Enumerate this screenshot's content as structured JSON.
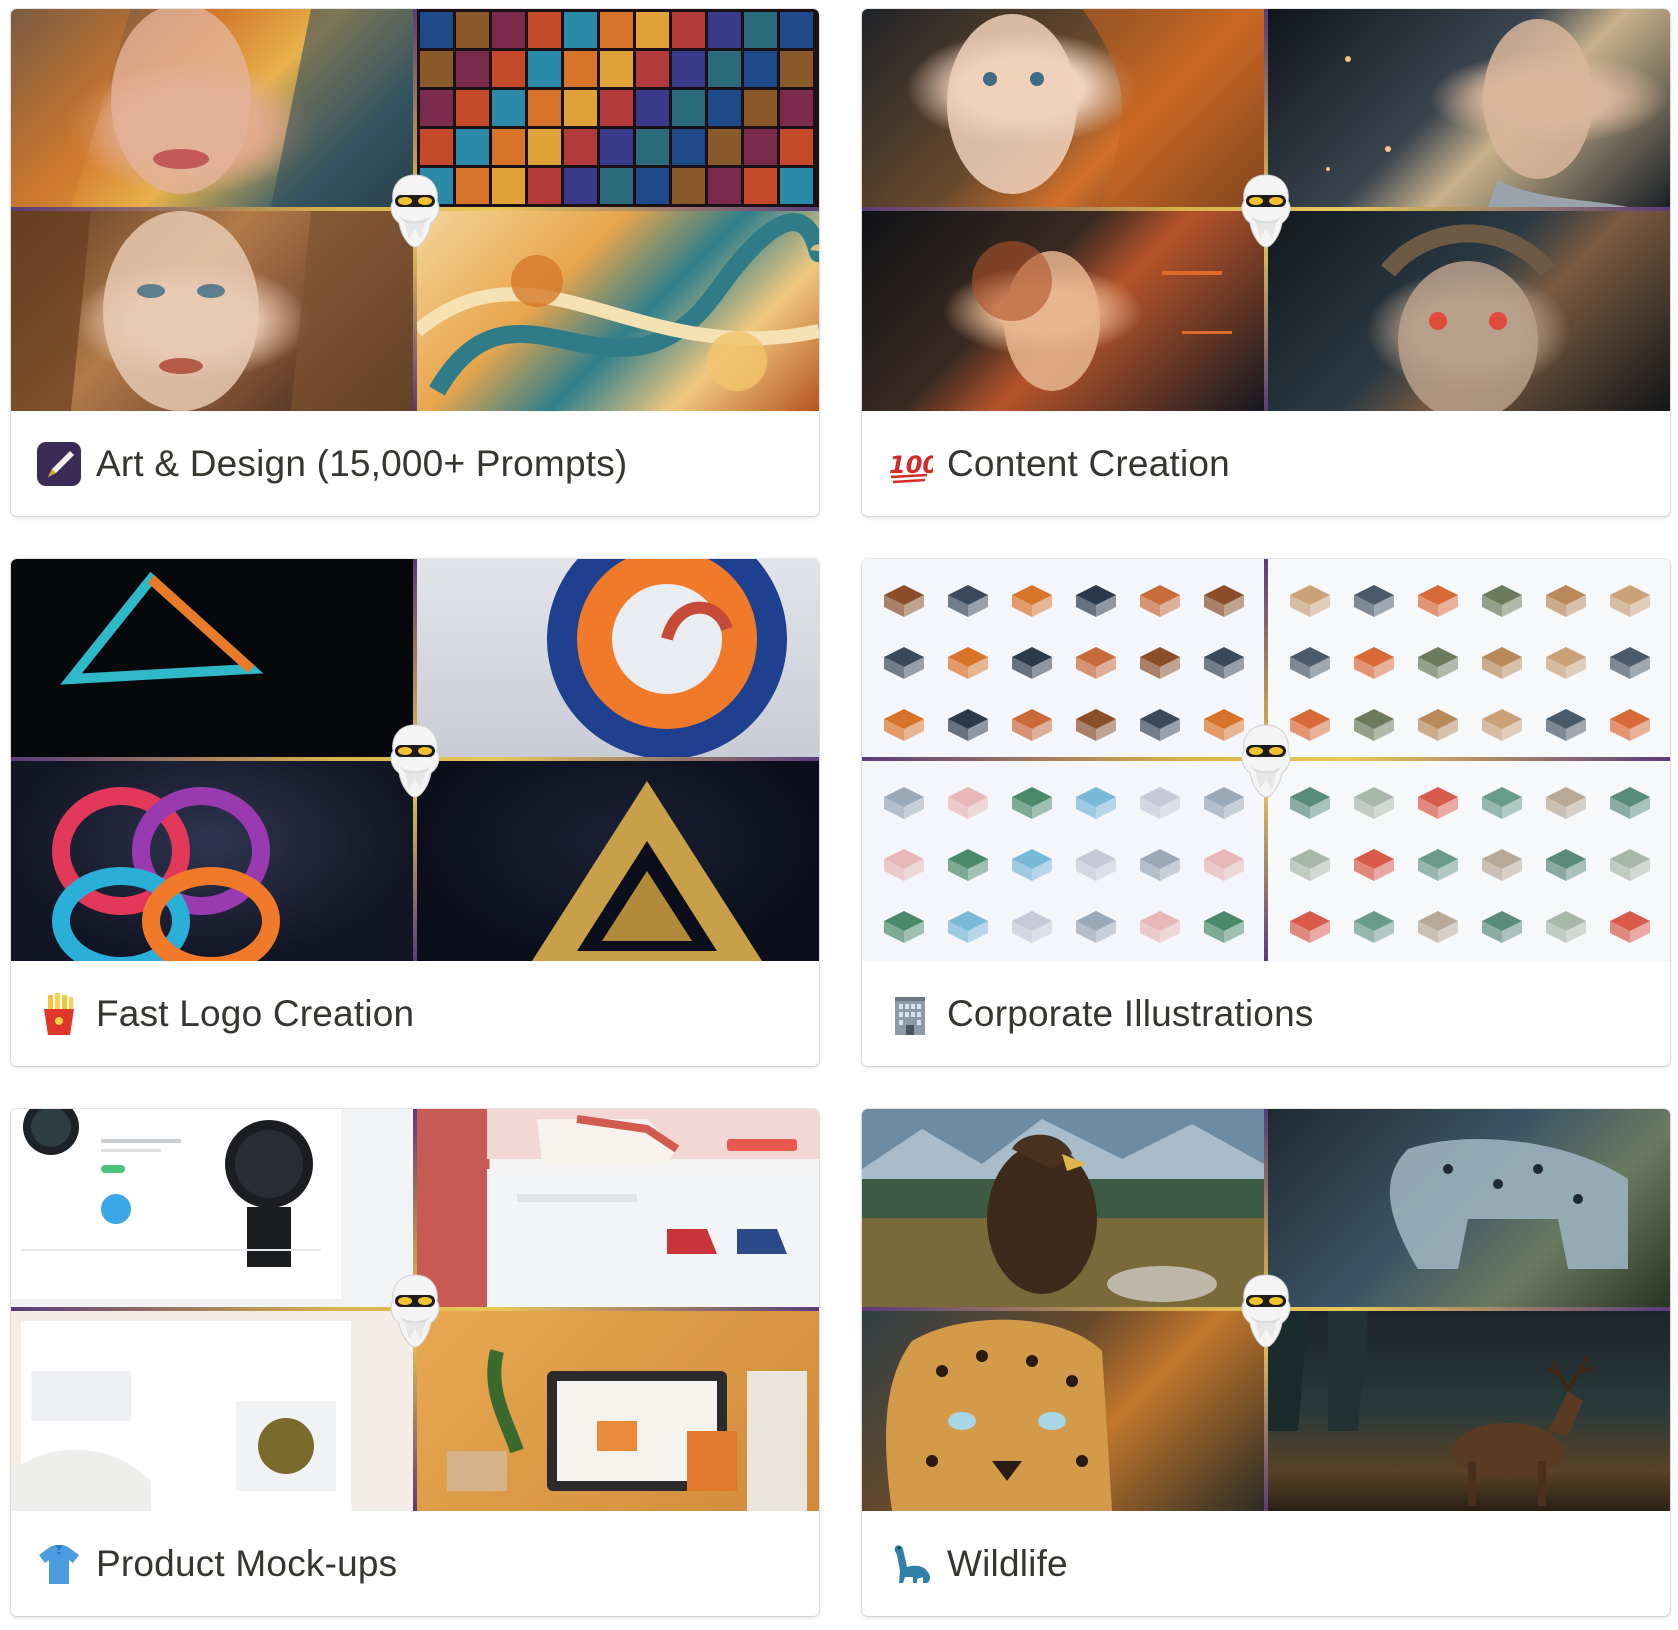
{
  "gallery": {
    "cards": [
      {
        "title": "Art & Design (15,000+ Prompts)",
        "icon": "paintbrush-icon"
      },
      {
        "title": "Content Creation",
        "icon": "hundred-points-icon"
      },
      {
        "title": "Fast Logo Creation",
        "icon": "french-fries-icon"
      },
      {
        "title": "Corporate Illustrations",
        "icon": "office-building-icon"
      },
      {
        "title": "Product Mock-ups",
        "icon": "t-shirt-icon"
      },
      {
        "title": "Wildlife",
        "icon": "sauropod-icon"
      }
    ]
  },
  "colors": {
    "title_text": "#37352f",
    "divider_gold": "#d8b24a",
    "card_border": "#e0dfdc"
  }
}
